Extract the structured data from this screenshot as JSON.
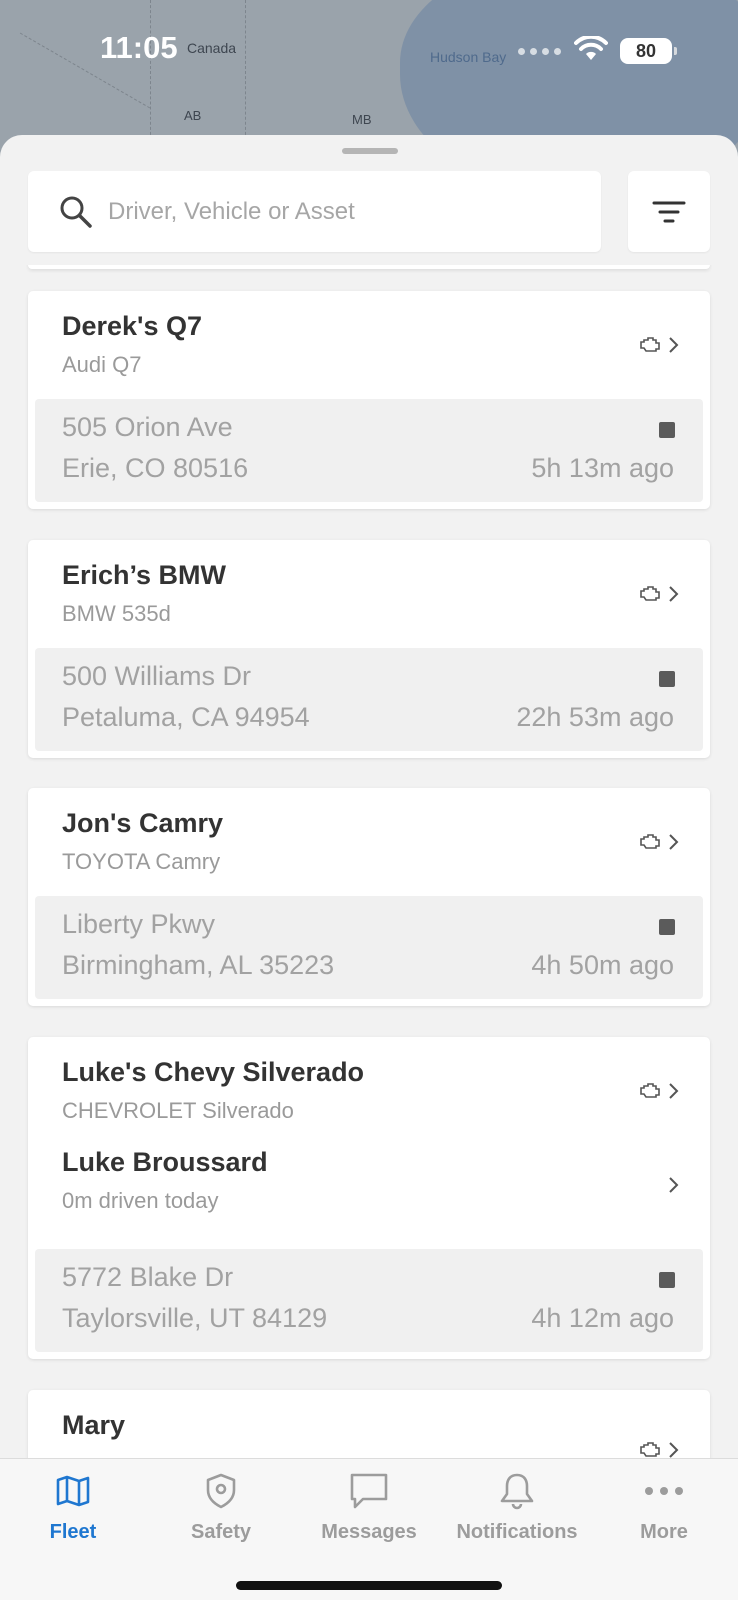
{
  "status_bar": {
    "time": "11:05",
    "battery": "80"
  },
  "map": {
    "labels": {
      "country": "Canada",
      "bay": "Hudson Bay",
      "province1": "AB",
      "province2": "MB"
    }
  },
  "search": {
    "placeholder": "Driver, Vehicle or Asset",
    "value": ""
  },
  "vehicles": [
    {
      "name": "Derek's Q7",
      "model": "Audi Q7",
      "address_line1": "505 Orion Ave",
      "address_line2": "Erie, CO 80516",
      "last_seen": "5h 13m ago"
    },
    {
      "name": "Erich’s BMW",
      "model": "BMW 535d",
      "address_line1": "500 Williams Dr",
      "address_line2": "Petaluma, CA 94954",
      "last_seen": "22h 53m ago"
    },
    {
      "name": "Jon's Camry",
      "model": "TOYOTA Camry",
      "address_line1": "Liberty Pkwy",
      "address_line2": "Birmingham, AL 35223",
      "last_seen": "4h 50m ago"
    },
    {
      "name": "Luke's Chevy Silverado",
      "model": "CHEVROLET Silverado",
      "driver_name": "Luke Broussard",
      "driver_detail": "0m driven today",
      "address_line1": "5772 Blake Dr",
      "address_line2": "Taylorsville, UT 84129",
      "last_seen": "4h 12m ago"
    },
    {
      "name": "Mary"
    }
  ],
  "tabs": [
    {
      "label": "Fleet",
      "icon": "map-icon",
      "active": true
    },
    {
      "label": "Safety",
      "icon": "shield-icon",
      "active": false
    },
    {
      "label": "Messages",
      "icon": "chat-bubble-icon",
      "active": false
    },
    {
      "label": "Notifications",
      "icon": "bell-icon",
      "active": false
    },
    {
      "label": "More",
      "icon": "ellipsis-icon",
      "active": false
    }
  ],
  "colors": {
    "accent": "#1f77d0",
    "inactive_tab": "#9c9c9c",
    "card_bg": "#ffffff",
    "address_bg": "#f0f0f0"
  }
}
